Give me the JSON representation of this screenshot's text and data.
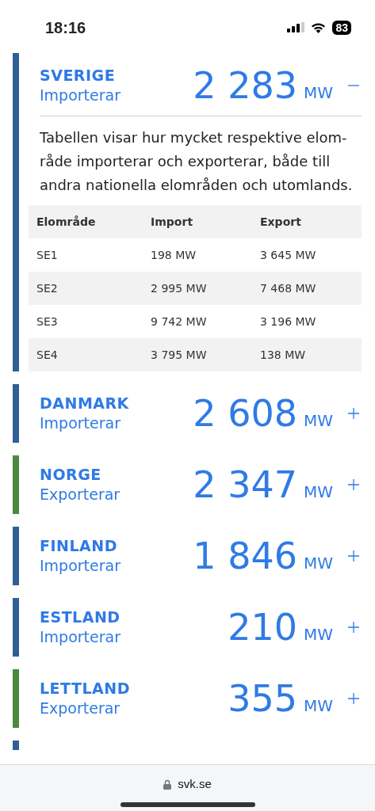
{
  "status_bar": {
    "time": "18:16",
    "battery": "83"
  },
  "regions": [
    {
      "name": "SVERIGE",
      "direction": "Importerar",
      "value": "2 283",
      "unit": "MW",
      "color": "#2f5f95",
      "expanded": true,
      "description": "Tabellen visar hur mycket respektive elom-råde importerar och exporterar, både till andra nationella elområden och utomlands.",
      "table": {
        "columns": [
          "Elområde",
          "Import",
          "Export"
        ],
        "rows": [
          [
            "SE1",
            "198 MW",
            "3 645 MW"
          ],
          [
            "SE2",
            "2 995 MW",
            "7 468 MW"
          ],
          [
            "SE3",
            "9 742 MW",
            "3 196 MW"
          ],
          [
            "SE4",
            "3 795 MW",
            "138 MW"
          ]
        ]
      }
    },
    {
      "name": "DANMARK",
      "direction": "Importerar",
      "value": "2 608",
      "unit": "MW",
      "color": "#2f5f95",
      "expanded": false
    },
    {
      "name": "NORGE",
      "direction": "Exporterar",
      "value": "2 347",
      "unit": "MW",
      "color": "#4a8a3e",
      "expanded": false
    },
    {
      "name": "FINLAND",
      "direction": "Importerar",
      "value": "1 846",
      "unit": "MW",
      "color": "#2f5f95",
      "expanded": false
    },
    {
      "name": "ESTLAND",
      "direction": "Importerar",
      "value": "210",
      "unit": "MW",
      "color": "#2f5f95",
      "expanded": false
    },
    {
      "name": "LETTLAND",
      "direction": "Exporterar",
      "value": "355",
      "unit": "MW",
      "color": "#4a8a3e",
      "expanded": false
    }
  ],
  "partial_region": {
    "color": "#2f5f95"
  },
  "browser_bar": {
    "address": "svk.se"
  }
}
